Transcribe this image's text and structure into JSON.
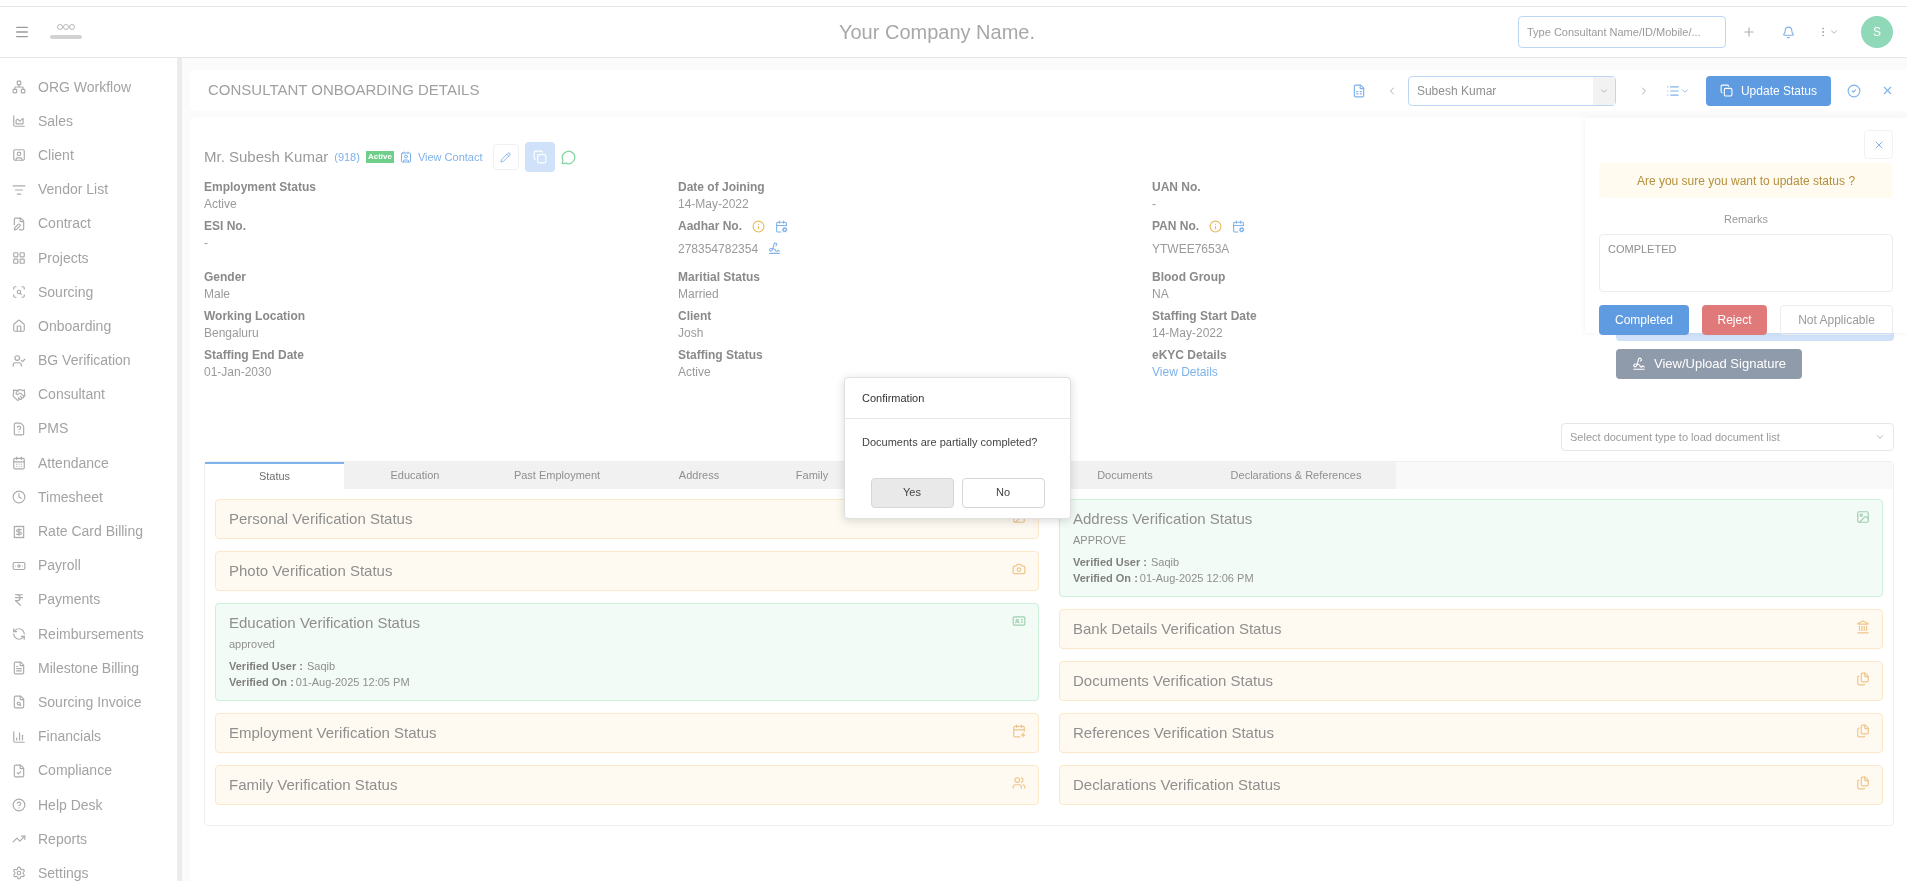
{
  "header": {
    "company_name": "Your Company Name.",
    "search_placeholder": "Type Consultant Name/ID/Mobile/...",
    "avatar_initial": "S"
  },
  "sidebar": {
    "items": [
      {
        "label": "ORG Workflow"
      },
      {
        "label": "Sales"
      },
      {
        "label": "Client"
      },
      {
        "label": "Vendor List"
      },
      {
        "label": "Contract"
      },
      {
        "label": "Projects"
      },
      {
        "label": "Sourcing"
      },
      {
        "label": "Onboarding"
      },
      {
        "label": "BG Verification"
      },
      {
        "label": "Consultant"
      },
      {
        "label": "PMS"
      },
      {
        "label": "Attendance"
      },
      {
        "label": "Timesheet"
      },
      {
        "label": "Rate Card Billing"
      },
      {
        "label": "Payroll"
      },
      {
        "label": "Payments"
      },
      {
        "label": "Reimbursements"
      },
      {
        "label": "Milestone Billing"
      },
      {
        "label": "Sourcing Invoice"
      },
      {
        "label": "Financials"
      },
      {
        "label": "Compliance"
      },
      {
        "label": "Help Desk"
      },
      {
        "label": "Reports"
      },
      {
        "label": "Settings"
      }
    ]
  },
  "toolbar": {
    "title": "CONSULTANT ONBOARDING DETAILS",
    "consultant_select": "Subesh Kumar",
    "update_status_button": "Update Status"
  },
  "profile": {
    "name": "Mr. Subesh Kumar",
    "id": "(918)",
    "status_badge": "Active",
    "view_contact": "View Contact"
  },
  "fields": [
    {
      "label": "Employment Status",
      "value": "Active",
      "kind": "text"
    },
    {
      "label": "Date of Joining",
      "value": "14-May-2022",
      "kind": "text"
    },
    {
      "label": "UAN No.",
      "value": "-",
      "kind": "text"
    },
    {
      "label": "ESI No.",
      "value": "-",
      "kind": "text"
    },
    {
      "label": "Aadhar No.",
      "value": "278354782354",
      "kind": "doc_esign"
    },
    {
      "label": "PAN No.",
      "value": "YTWEE7653A",
      "kind": "doc"
    },
    {
      "label": "Gender",
      "value": "Male",
      "kind": "text"
    },
    {
      "label": "Maritial Status",
      "value": "Married",
      "kind": "text"
    },
    {
      "label": "Blood Group",
      "value": "NA",
      "kind": "text"
    },
    {
      "label": "Working Location",
      "value": "Bengaluru",
      "kind": "text"
    },
    {
      "label": "Client",
      "value": "Josh",
      "kind": "text"
    },
    {
      "label": "Staffing Start Date",
      "value": "14-May-2022",
      "kind": "text"
    },
    {
      "label": "Staffing End Date",
      "value": "01-Jan-2030",
      "kind": "text"
    },
    {
      "label": "Staffing Status",
      "value": "Active",
      "kind": "text"
    },
    {
      "label": "eKYC Details",
      "value": "View Details",
      "kind": "link"
    }
  ],
  "signature_button": "View/Upload Signature",
  "document_select": {
    "placeholder": "Select document type to load document list"
  },
  "tabs": [
    {
      "label": "Status",
      "selected": true
    },
    {
      "label": "Education",
      "selected": false
    },
    {
      "label": "Past Employment",
      "selected": false
    },
    {
      "label": "Address",
      "selected": false
    },
    {
      "label": "Family",
      "selected": false
    },
    {
      "label": "Documents",
      "selected": false
    },
    {
      "label": "Declarations & References",
      "selected": false
    }
  ],
  "cards_left": [
    {
      "title": "Personal Verification Status",
      "kind": "pending"
    },
    {
      "title": "Photo Verification Status",
      "kind": "pending"
    },
    {
      "title": "Education Verification Status",
      "kind": "verified",
      "result": "approved",
      "user_label": "Verified User :",
      "user": "Saqib",
      "date_label": "Verified On :",
      "date": "01-Aug-2025 12:05 PM"
    },
    {
      "title": "Employment Verification Status",
      "kind": "pending"
    },
    {
      "title": "Family Verification Status",
      "kind": "pending"
    }
  ],
  "cards_right": [
    {
      "title": "Address Verification Status",
      "kind": "verified",
      "result": "APPROVE",
      "user_label": "Verified User :",
      "user": "Saqib",
      "date_label": "Verified On :",
      "date": "01-Aug-2025 12:06 PM"
    },
    {
      "title": "Bank Details Verification Status",
      "kind": "pending"
    },
    {
      "title": "Documents Verification Status",
      "kind": "pending"
    },
    {
      "title": "References Verification Status",
      "kind": "pending"
    },
    {
      "title": "Declarations Verification Status",
      "kind": "pending"
    }
  ],
  "popover": {
    "message": "Are you sure you want to update status ?",
    "remarks_label": "Remarks",
    "remarks_value": "COMPLETED",
    "buttons": [
      {
        "label": "Completed",
        "kind": "primary"
      },
      {
        "label": "Reject",
        "kind": "danger"
      },
      {
        "label": "Not Applicable",
        "kind": "plain"
      }
    ]
  },
  "modal": {
    "title": "Confirmation",
    "message": "Documents are partially completed?",
    "buttons": [
      {
        "label": "Yes",
        "selected": true
      },
      {
        "label": "No",
        "selected": false
      }
    ]
  }
}
